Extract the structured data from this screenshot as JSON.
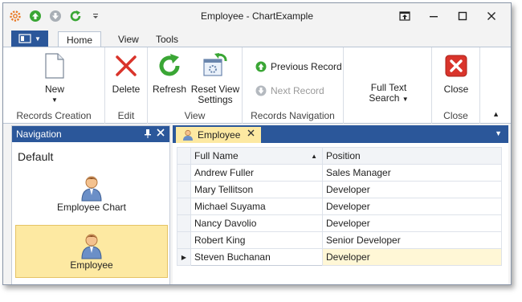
{
  "window": {
    "title": "Employee - ChartExample"
  },
  "quick_access": [
    {
      "icon": "gear-icon",
      "color": "#e87722"
    },
    {
      "icon": "arrow-up-icon",
      "color": "#3aa635"
    },
    {
      "icon": "arrow-down-icon",
      "color": "#9aa0a6"
    },
    {
      "icon": "refresh-icon",
      "color": "#3aa635"
    },
    {
      "icon": "customize-dropdown-icon"
    }
  ],
  "ribbon_tabs": [
    "Home",
    "View",
    "Tools"
  ],
  "ribbon": {
    "groups": {
      "records_creation": "Records Creation",
      "edit": "Edit",
      "view": "View",
      "records_navigation": "Records Navigation",
      "close": "Close"
    },
    "new_label": "New",
    "delete_label": "Delete",
    "refresh_label": "Refresh",
    "reset_view_label_1": "Reset View",
    "reset_view_label_2": "Settings",
    "previous_record_label": "Previous Record",
    "next_record_label": "Next Record",
    "full_text_label_1": "Full Text",
    "full_text_label_2": "Search",
    "close_label": "Close"
  },
  "navigation": {
    "header": "Navigation",
    "group": "Default",
    "items": [
      {
        "label": "Employee Chart",
        "selected": false
      },
      {
        "label": "Employee",
        "selected": true
      }
    ]
  },
  "document": {
    "tab_label": "Employee",
    "columns": [
      "Full Name",
      "Position"
    ],
    "rows": [
      {
        "name": "Andrew Fuller",
        "position": "Sales Manager"
      },
      {
        "name": "Mary Tellitson",
        "position": "Developer"
      },
      {
        "name": "Michael Suyama",
        "position": "Developer"
      },
      {
        "name": "Nancy Davolio",
        "position": "Developer"
      },
      {
        "name": "Robert King",
        "position": "Senior Developer"
      },
      {
        "name": "Steven Buchanan",
        "position": "Developer"
      }
    ]
  },
  "colors": {
    "accent": "#2b579a",
    "selection": "#fde9a2",
    "close_red": "#d9342b",
    "refresh_green": "#3aa635"
  }
}
